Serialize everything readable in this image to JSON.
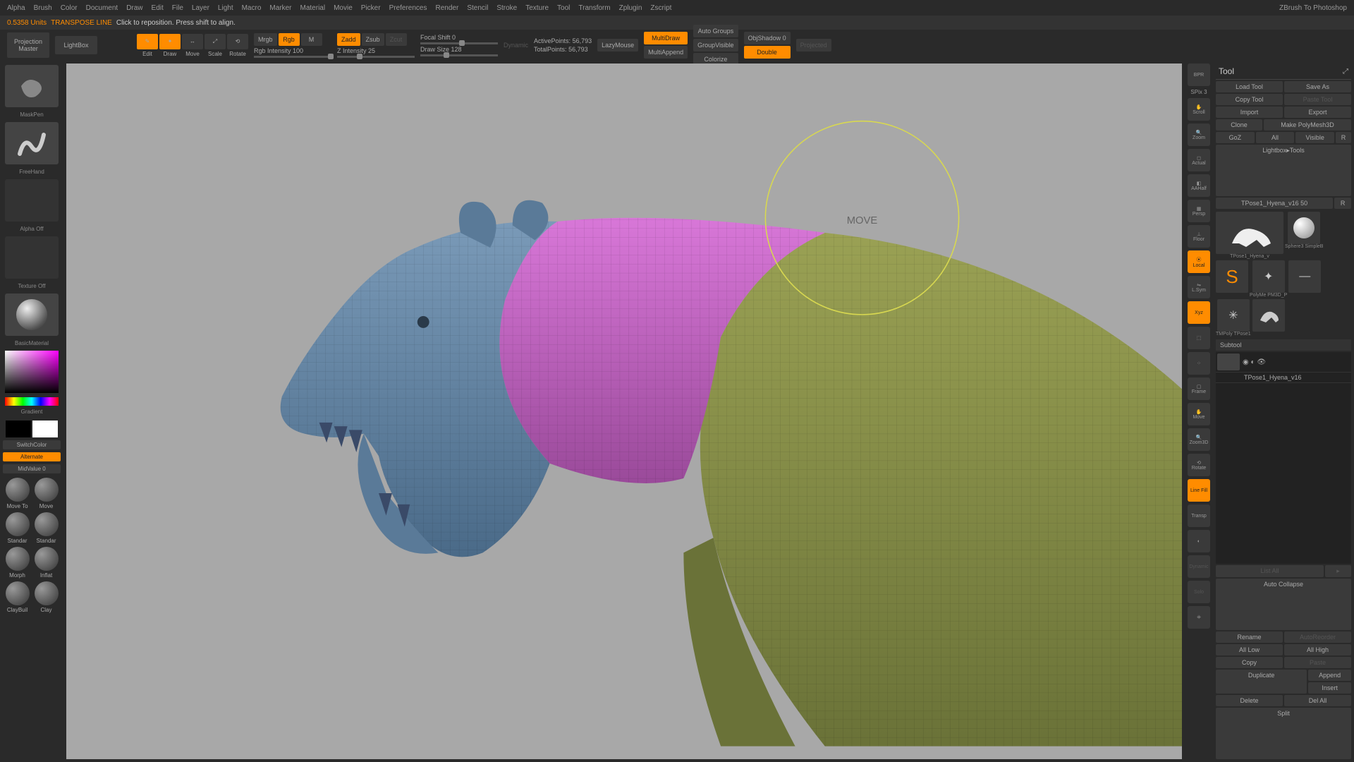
{
  "app": {
    "title": "ZBrush To Photoshop"
  },
  "menu": [
    "Alpha",
    "Brush",
    "Color",
    "Document",
    "Draw",
    "Edit",
    "File",
    "Layer",
    "Light",
    "Macro",
    "Marker",
    "Material",
    "Movie",
    "Picker",
    "Preferences",
    "Render",
    "Stencil",
    "Stroke",
    "Texture",
    "Tool",
    "Transform",
    "Zplugin",
    "Zscript"
  ],
  "status": {
    "units": "0.5358 Units",
    "mode": "TRANSPOSE LINE",
    "hint": "Click to reposition. Press shift to align."
  },
  "toolbar": {
    "projection": "Projection\nMaster",
    "lightbox": "LightBox",
    "edit": "Edit",
    "draw": "Draw",
    "move": "Move",
    "scale": "Scale",
    "rotate": "Rotate",
    "mrgb": "Mrgb",
    "rgb": "Rgb",
    "m": "M",
    "rgb_intensity_label": "Rgb Intensity",
    "rgb_intensity_value": "100",
    "zadd": "Zadd",
    "zsub": "Zsub",
    "zcut": "Zcut",
    "z_intensity_label": "Z Intensity",
    "z_intensity_value": "25",
    "focal_shift_label": "Focal Shift",
    "focal_shift_value": "0",
    "draw_size_label": "Draw Size",
    "draw_size_value": "128",
    "dynamic": "Dynamic",
    "active_points_label": "ActivePoints:",
    "active_points_value": "56,793",
    "total_points_label": "TotalPoints:",
    "total_points_value": "56,793",
    "lazymouse": "LazyMouse",
    "multidraw": "MultiDraw",
    "multiappend": "MultiAppend",
    "autogroups": "Auto Groups",
    "groupvisible": "GroupVisible",
    "colorize": "Colorize",
    "objshadow": "ObjShadow 0",
    "double": "Double",
    "projected": "Projected"
  },
  "left": {
    "maskpen": "MaskPen",
    "freehand": "FreeHand",
    "alpha_off": "Alpha Off",
    "texture_off": "Texture Off",
    "basicmaterial": "BasicMaterial",
    "gradient": "Gradient",
    "switchcolor": "SwitchColor",
    "alternate": "Alternate",
    "midvalue": "MidValue 0",
    "brushes": [
      "Move To",
      "Move",
      "Standar",
      "Standar",
      "Morph",
      "Inflat",
      "ClayBuil",
      "Clay"
    ]
  },
  "rail": {
    "bpr": "BPR",
    "spix": "SPix",
    "spix_val": "3",
    "scroll": "Scroll",
    "zoom": "Zoom",
    "actual": "Actual",
    "aahalf": "AAHalf",
    "persp": "Persp",
    "floor": "Floor",
    "local": "Local",
    "lsym": "L.Sym",
    "xyz": "Xyz",
    "frame": "Frame",
    "move": "Move",
    "zoom3d": "Zoom3D",
    "rotate": "Rotate",
    "transp": "Transp",
    "linefill": "Line Fill",
    "dynamic": "Dynamic",
    "solo": "Solo"
  },
  "tool_panel": {
    "title": "Tool",
    "load": "Load Tool",
    "saveas": "Save As",
    "copy": "Copy Tool",
    "paste": "Paste Tool",
    "import": "Import",
    "export": "Export",
    "clone": "Clone",
    "makepoly": "Make PolyMesh3D",
    "goz": "GoZ",
    "all": "All",
    "visible": "Visible",
    "r": "R",
    "lightbox_tools": "Lightbox▸Tools",
    "active_tool": "TPose1_Hyena_v16",
    "active_tool_val": "50",
    "thumbs": [
      {
        "name": "TPose1_Hyena_v",
        "label": "TPose1_Hyena_v"
      },
      {
        "name": "Sphere3D",
        "label": "Sphere3 SimpleB"
      },
      {
        "name": "PolyMesh",
        "label": "PolyMe PM3D_P"
      },
      {
        "name": "TMPoly",
        "label": "TMPoly TPose1"
      }
    ]
  },
  "subtool": {
    "header": "Subtool",
    "items": [
      {
        "name": "TPose1_Hyena_v16"
      }
    ],
    "listall": "List All",
    "autocollapse": "Auto Collapse",
    "rename": "Rename",
    "autoreorder": "AutoReorder",
    "alllow": "All Low",
    "allhigh": "All High",
    "copy": "Copy",
    "paste": "Paste",
    "duplicate": "Duplicate",
    "append": "Append",
    "insert": "Insert",
    "delete": "Delete",
    "delall": "Del All",
    "split": "Split"
  },
  "canvas": {
    "cursor_label": "MOVE"
  }
}
